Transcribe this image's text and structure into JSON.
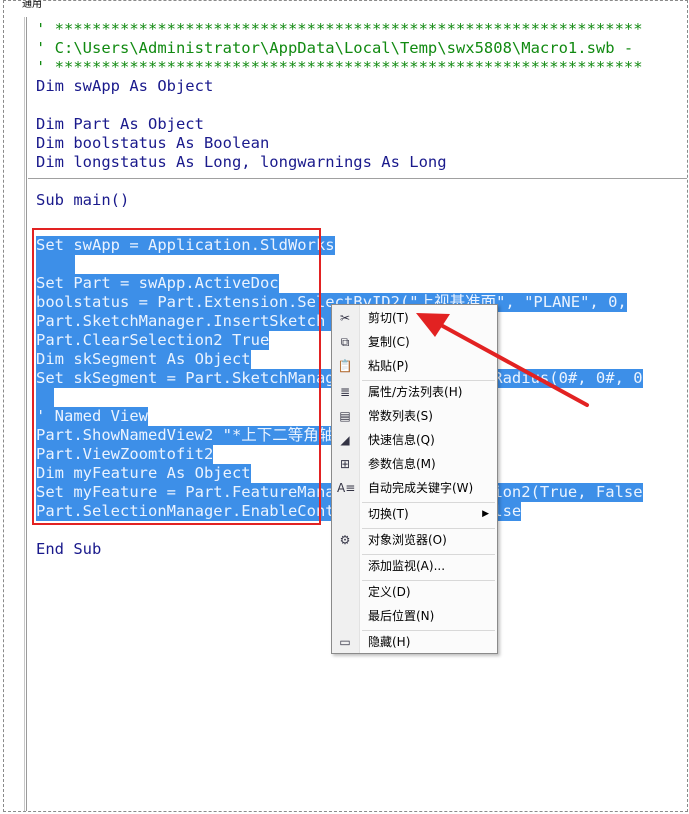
{
  "window": {
    "tab_label": "通用"
  },
  "code_lines": [
    "' ***************************************************************",
    "' C:\\Users\\Administrator\\AppData\\Local\\Temp\\swx5808\\Macro1.swb -",
    "' ***************************************************************",
    "Dim swApp As Object",
    "",
    "Dim Part As Object",
    "Dim boolstatus As Boolean",
    "Dim longstatus As Long, longwarnings As Long",
    "",
    "Sub main()",
    "",
    "Set swApp = Application.SldWorks",
    "",
    "Set Part = swApp.ActiveDoc",
    "boolstatus = Part.Extension.SelectByID2(\"上视基准面\", \"PLANE\", 0,",
    "Part.SketchManager.InsertSketch True",
    "Part.ClearSelection2 True",
    "Dim skSegment As Object",
    "Set skSegment = Part.SketchManager.CreateCircleByRadius(0#, 0#, 0",
    "",
    "' Named View",
    "Part.ShowNamedView2 \"*上下二等角轴测\", 8",
    "Part.ViewZoomtofit2",
    "Dim myFeature As Object",
    "Set myFeature = Part.FeatureManager.FeatureExtrusion2(True, False",
    "Part.SelectionManager.EnableContourSelection = False",
    "",
    "End Sub"
  ],
  "context_menu": {
    "items": [
      {
        "label": "剪切(T)",
        "icon": "scissors-icon"
      },
      {
        "label": "复制(C)",
        "icon": "copy-icon"
      },
      {
        "label": "粘贴(P)",
        "icon": "paste-icon"
      },
      {
        "label": "属性/方法列表(H)",
        "icon": "list-members-icon"
      },
      {
        "label": "常数列表(S)",
        "icon": "constants-icon"
      },
      {
        "label": "快速信息(Q)",
        "icon": "quick-info-icon"
      },
      {
        "label": "参数信息(M)",
        "icon": "param-info-icon"
      },
      {
        "label": "自动完成关键字(W)",
        "icon": "complete-word-icon"
      },
      {
        "label": "切换(T)",
        "icon": ""
      },
      {
        "label": "对象浏览器(O)",
        "icon": "object-browser-icon"
      },
      {
        "label": "添加监视(A)...",
        "icon": ""
      },
      {
        "label": "定义(D)",
        "icon": ""
      },
      {
        "label": "最后位置(N)",
        "icon": ""
      },
      {
        "label": "隐藏(H)",
        "icon": "hide-icon"
      }
    ]
  },
  "annotation": {
    "color": "#e22222"
  }
}
